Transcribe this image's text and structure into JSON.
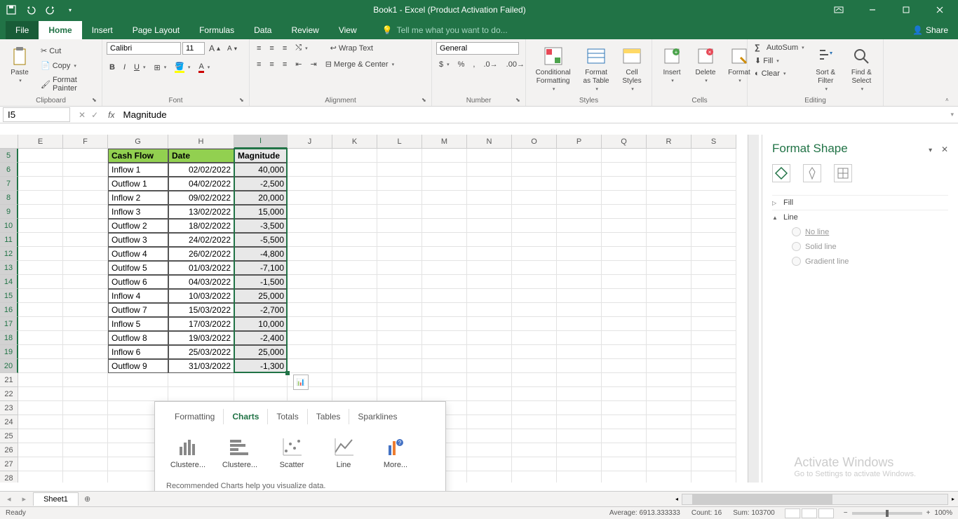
{
  "title": "Book1 - Excel (Product Activation Failed)",
  "tabs": {
    "file": "File",
    "home": "Home",
    "insert": "Insert",
    "pageLayout": "Page Layout",
    "formulas": "Formulas",
    "data": "Data",
    "review": "Review",
    "view": "View"
  },
  "tellme": "Tell me what you want to do...",
  "share": "Share",
  "clipboard": {
    "paste": "Paste",
    "cut": "Cut",
    "copy": "Copy",
    "formatPainter": "Format Painter",
    "label": "Clipboard"
  },
  "font": {
    "name": "Calibri",
    "size": "11",
    "label": "Font"
  },
  "alignment": {
    "wrap": "Wrap Text",
    "merge": "Merge & Center",
    "label": "Alignment"
  },
  "number": {
    "format": "General",
    "label": "Number"
  },
  "styles": {
    "cond": "Conditional Formatting",
    "table": "Format as Table",
    "cell": "Cell Styles",
    "label": "Styles"
  },
  "cellsGroup": {
    "insert": "Insert",
    "delete": "Delete",
    "format": "Format",
    "label": "Cells"
  },
  "editing": {
    "autosum": "AutoSum",
    "fill": "Fill",
    "clear": "Clear",
    "sort": "Sort & Filter",
    "find": "Find & Select",
    "label": "Editing"
  },
  "namebox": "I5",
  "formula": "Magnitude",
  "columns": [
    "E",
    "F",
    "G",
    "H",
    "I",
    "J",
    "K",
    "L",
    "M",
    "N",
    "O",
    "P",
    "Q",
    "R",
    "S"
  ],
  "rows": [
    5,
    6,
    7,
    8,
    9,
    10,
    11,
    12,
    13,
    14,
    15,
    16,
    17,
    18,
    19,
    20,
    21,
    22,
    23,
    24,
    25,
    26,
    27,
    28
  ],
  "tableHeaders": {
    "g": "Cash Flow",
    "h": "Date",
    "i": "Magnitude"
  },
  "tableRows": [
    {
      "g": "Inflow 1",
      "h": "02/02/2022",
      "i": "40,000"
    },
    {
      "g": "Outflow 1",
      "h": "04/02/2022",
      "i": "-2,500"
    },
    {
      "g": "Inflow 2",
      "h": "09/02/2022",
      "i": "20,000"
    },
    {
      "g": "Inflow 3",
      "h": "13/02/2022",
      "i": "15,000"
    },
    {
      "g": "Outflow 2",
      "h": "18/02/2022",
      "i": "-3,500"
    },
    {
      "g": "Outflow 3",
      "h": "24/02/2022",
      "i": "-5,500"
    },
    {
      "g": "Outflow 4",
      "h": "26/02/2022",
      "i": "-4,800"
    },
    {
      "g": "Outlfow 5",
      "h": "01/03/2022",
      "i": "-7,100"
    },
    {
      "g": "Outflow 6",
      "h": "04/03/2022",
      "i": "-1,500"
    },
    {
      "g": "Inflow 4",
      "h": "10/03/2022",
      "i": "25,000"
    },
    {
      "g": "Outflow 7",
      "h": "15/03/2022",
      "i": "-2,700"
    },
    {
      "g": "Inflow 5",
      "h": "17/03/2022",
      "i": "10,000"
    },
    {
      "g": "Outflow 8",
      "h": "19/03/2022",
      "i": "-2,400"
    },
    {
      "g": "Inflow 6",
      "h": "25/03/2022",
      "i": "25,000"
    },
    {
      "g": "Outflow 9",
      "h": "31/03/2022",
      "i": "-1,300"
    }
  ],
  "qa": {
    "tabs": {
      "formatting": "Formatting",
      "charts": "Charts",
      "totals": "Totals",
      "tables": "Tables",
      "sparklines": "Sparklines"
    },
    "items": {
      "clustered1": "Clustere...",
      "clustered2": "Clustere...",
      "scatter": "Scatter",
      "line": "Line",
      "more": "More..."
    },
    "desc": "Recommended Charts help you visualize data."
  },
  "pane": {
    "title": "Format Shape",
    "fill": "Fill",
    "line": "Line",
    "noLine": "No line",
    "solid": "Solid line",
    "gradient": "Gradient line"
  },
  "sheet": "Sheet1",
  "status": {
    "ready": "Ready",
    "avg": "Average: 6913.333333",
    "count": "Count: 16",
    "sum": "Sum: 103700",
    "zoom": "100%"
  },
  "watermark": {
    "title": "Activate Windows",
    "sub": "Go to Settings to activate Windows."
  }
}
